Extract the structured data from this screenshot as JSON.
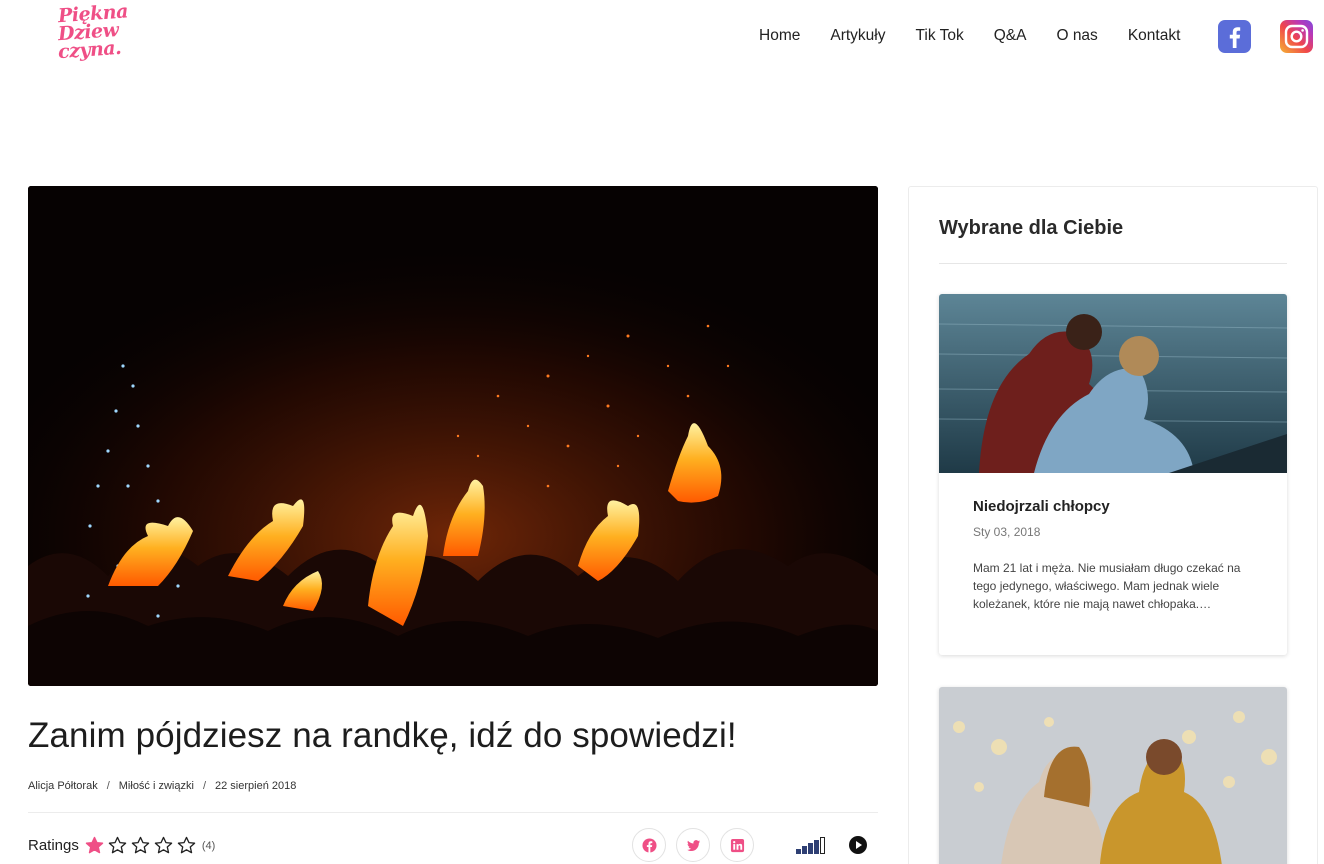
{
  "brand": {
    "logo_lines": [
      "Piękna",
      "Dziew",
      "czyna."
    ],
    "accent_color": "#ef4f86"
  },
  "nav": {
    "items": [
      "Home",
      "Artykuły",
      "Tik Tok",
      "Q&A",
      "O nas",
      "Kontakt"
    ],
    "social": [
      "facebook-icon",
      "instagram-icon"
    ]
  },
  "article": {
    "title": "Zanim pójdziesz na randkę, idź do spowiedzi!",
    "author": "Alicja Półtorak",
    "category": "Miłość i związki",
    "date": "22 sierpień 2018",
    "separator": "/",
    "ratings_label": "Ratings",
    "rating_value": 1,
    "rating_max": 5,
    "rating_count": "(4)",
    "share_icons": [
      "facebook-icon",
      "twitter-icon",
      "linkedin-icon"
    ]
  },
  "sidebar": {
    "title": "Wybrane dla Ciebie",
    "cards": [
      {
        "title": "Niedojrzali chłopcy",
        "date": "Sty 03, 2018",
        "excerpt": "Mam 21 lat i męża. Nie musiałam długo czekać na tego jedynego, właściwego. Mam jednak wiele koleżanek, które nie mają nawet chłopaka.…"
      },
      {
        "title": "",
        "date": "",
        "excerpt": ""
      }
    ]
  }
}
